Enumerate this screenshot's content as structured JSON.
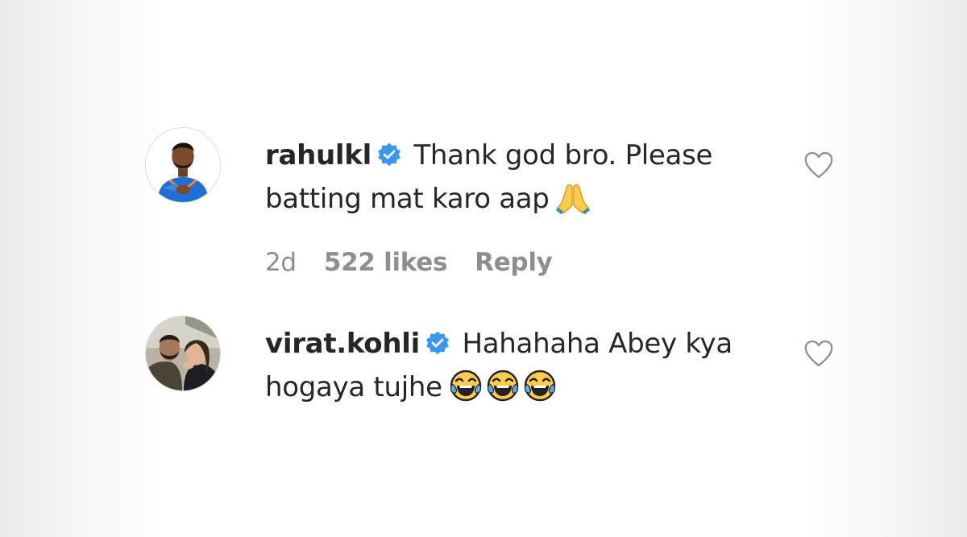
{
  "comments": [
    {
      "username": "rahulkl",
      "verified": true,
      "text_line1": "Thank god bro. Please",
      "text_line2": "batting mat karo aap",
      "emojis": [
        "folded-hands"
      ],
      "time": "2d",
      "likes": "522 likes",
      "reply": "Reply"
    },
    {
      "username": "virat.kohli",
      "verified": true,
      "text_line1": "Hahahaha Abey kya",
      "text_line2": "hogaya tujhe",
      "emojis": [
        "tears-of-joy",
        "tears-of-joy",
        "tears-of-joy"
      ]
    }
  ],
  "colors": {
    "text": "#262626",
    "meta": "#8e8e8e",
    "verified_blue": "#3897f0",
    "heart_outline": "#8e8e8e"
  },
  "icons": {
    "verified": "verified-badge-icon",
    "like": "heart-outline-icon"
  }
}
